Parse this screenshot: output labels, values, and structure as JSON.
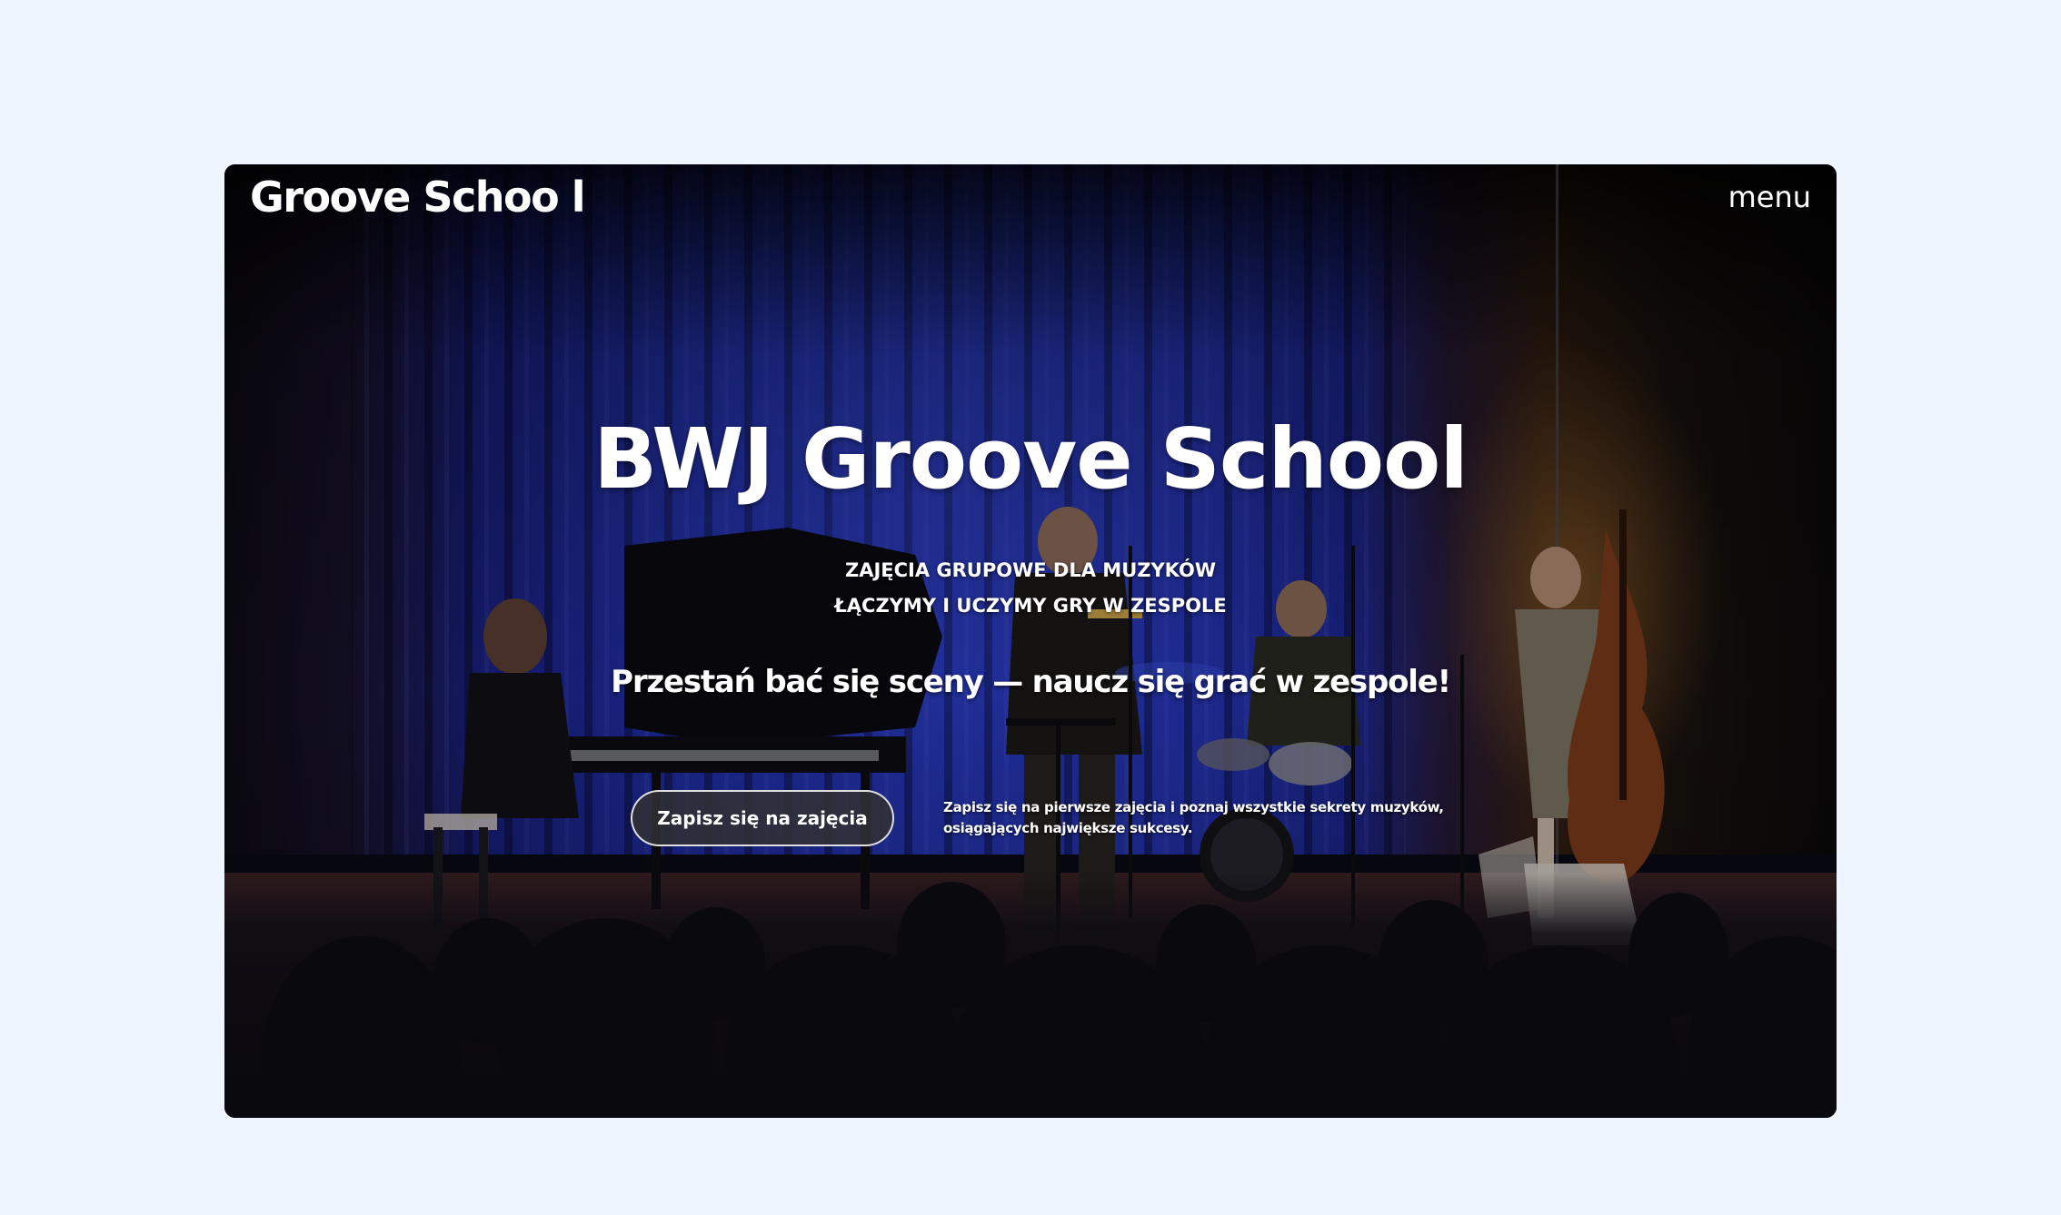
{
  "header": {
    "logo_text": "Groove Schoo l",
    "menu_label": "menu"
  },
  "hero": {
    "title": "BWJ Groove School",
    "subtitle_line1": "ZAJĘCIA GRUPOWE DLA MUZYKÓW",
    "subtitle_line2": "ŁĄCZYMY I UCZYMY GRY W ZESPOLE",
    "tagline": "Przestań bać się sceny — naucz się grać w zespole!",
    "cta_label": "Zapisz się na zajęcia",
    "cta_description": "Zapisz się na pierwsze zajęcia i poznaj wszystkie sekrety muzyków, osiągających największe sukcesy."
  },
  "colors": {
    "page_background": "#eef5fe",
    "curtain_blue": "#2a3cc4",
    "text": "#ffffff",
    "button_background": "#303034"
  }
}
